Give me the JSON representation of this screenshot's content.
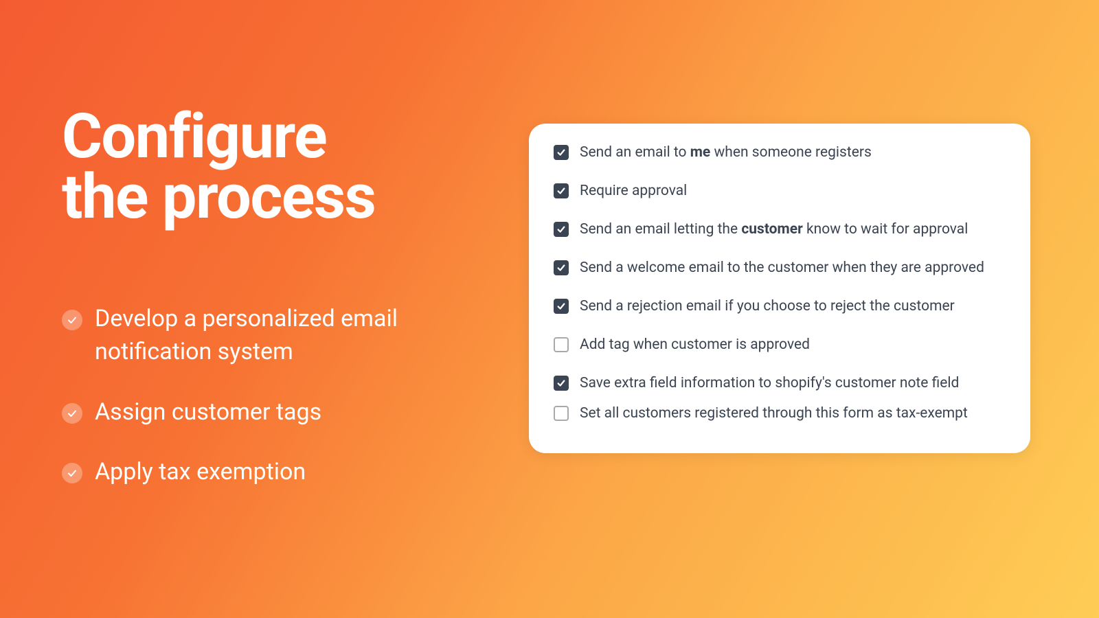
{
  "heading": {
    "line1": "Configure",
    "line2": "the process"
  },
  "bullets": [
    "Develop a personalized email notification system",
    "Assign customer tags",
    "Apply tax exemption"
  ],
  "card": {
    "options": [
      {
        "checked": true,
        "label_pre": "Send an email to ",
        "label_bold": "me",
        "label_post": " when someone registers"
      },
      {
        "checked": true,
        "label_pre": "Require approval",
        "label_bold": "",
        "label_post": ""
      },
      {
        "checked": true,
        "label_pre": "Send an email letting the ",
        "label_bold": "customer",
        "label_post": " know to wait for approval"
      },
      {
        "checked": true,
        "label_pre": "Send a welcome email to the customer when they are approved",
        "label_bold": "",
        "label_post": ""
      },
      {
        "checked": true,
        "label_pre": "Send a rejection email if you choose to reject the customer",
        "label_bold": "",
        "label_post": ""
      },
      {
        "checked": false,
        "label_pre": "Add tag when customer is approved",
        "label_bold": "",
        "label_post": ""
      },
      {
        "checked": true,
        "label_pre": "Save extra field information to shopify's customer note field",
        "label_bold": "",
        "label_post": ""
      },
      {
        "checked": false,
        "label_pre": "Set all customers registered through this form as tax-exempt",
        "label_bold": "",
        "label_post": ""
      }
    ]
  }
}
